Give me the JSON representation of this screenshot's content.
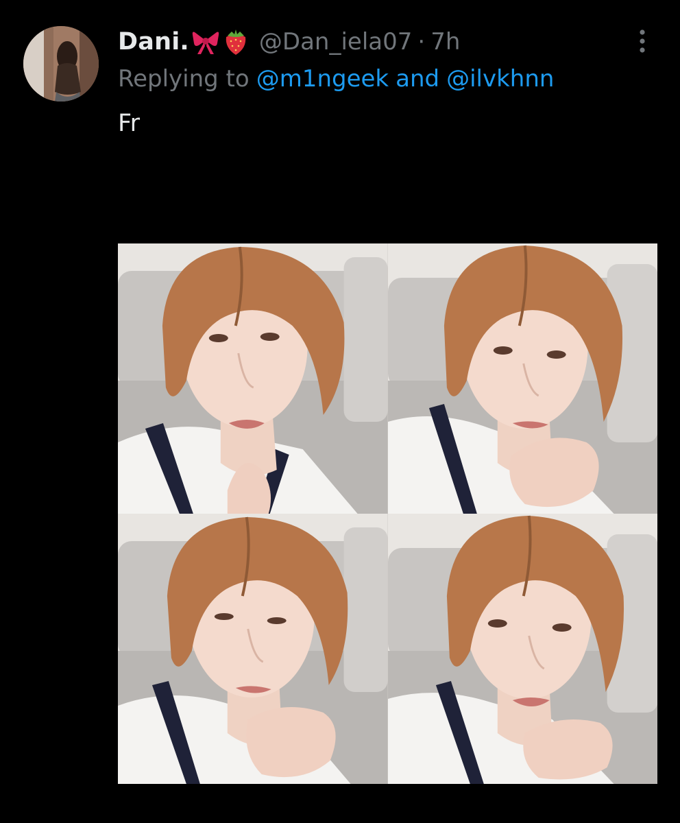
{
  "tweet": {
    "author": {
      "display_name": "Dani.",
      "name_emojis": [
        "ribbon-emoji",
        "strawberry-emoji"
      ],
      "handle": "@Dan_iela07",
      "separator": "·",
      "time": "7h",
      "avatar_icon": "profile-avatar"
    },
    "reply": {
      "prefix": "Replying to",
      "mention_1": "@m1ngeek",
      "joiner": "and",
      "mention_2": "@ilvkhnn"
    },
    "text": "Fr",
    "more_icon": "more-options-icon",
    "media": [
      {
        "name": "photo-1"
      },
      {
        "name": "photo-2"
      },
      {
        "name": "photo-3"
      },
      {
        "name": "photo-4"
      }
    ]
  },
  "colors": {
    "background": "#000000",
    "text_primary": "#e7e9ea",
    "text_secondary": "#71767b",
    "link": "#1d9bf0",
    "hair": "#b9774a",
    "skin": "#f2d6c8",
    "sofa": "#c9c6c3",
    "wall": "#e9e6e2"
  }
}
